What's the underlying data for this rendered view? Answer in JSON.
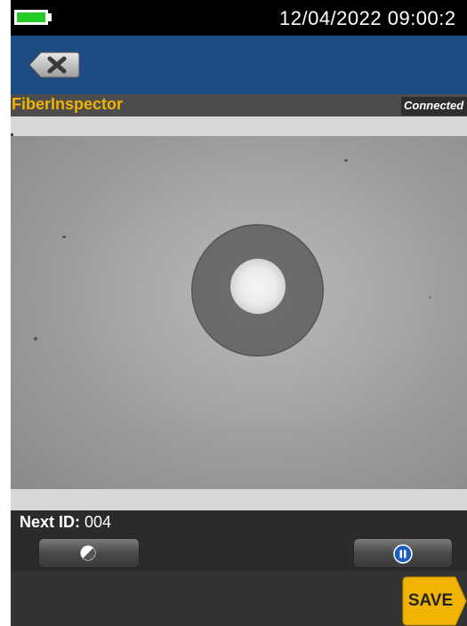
{
  "status_bar": {
    "datetime": "12/04/2022 09:00:2",
    "battery_icon": "battery-icon",
    "battery_color": "#22cc22"
  },
  "header": {
    "back_icon": "back-delete-icon",
    "background_color": "#1e4b84"
  },
  "title_bar": {
    "app_title": "FiberInspector",
    "connection_status": "Connected",
    "title_color": "#f0b400"
  },
  "controls": {
    "next_id_label": "Next ID:",
    "next_id_value": "004",
    "contrast_icon": "contrast-icon",
    "pause_icon": "pause-icon",
    "save_label": "SAVE",
    "save_color": "#f0b400"
  }
}
